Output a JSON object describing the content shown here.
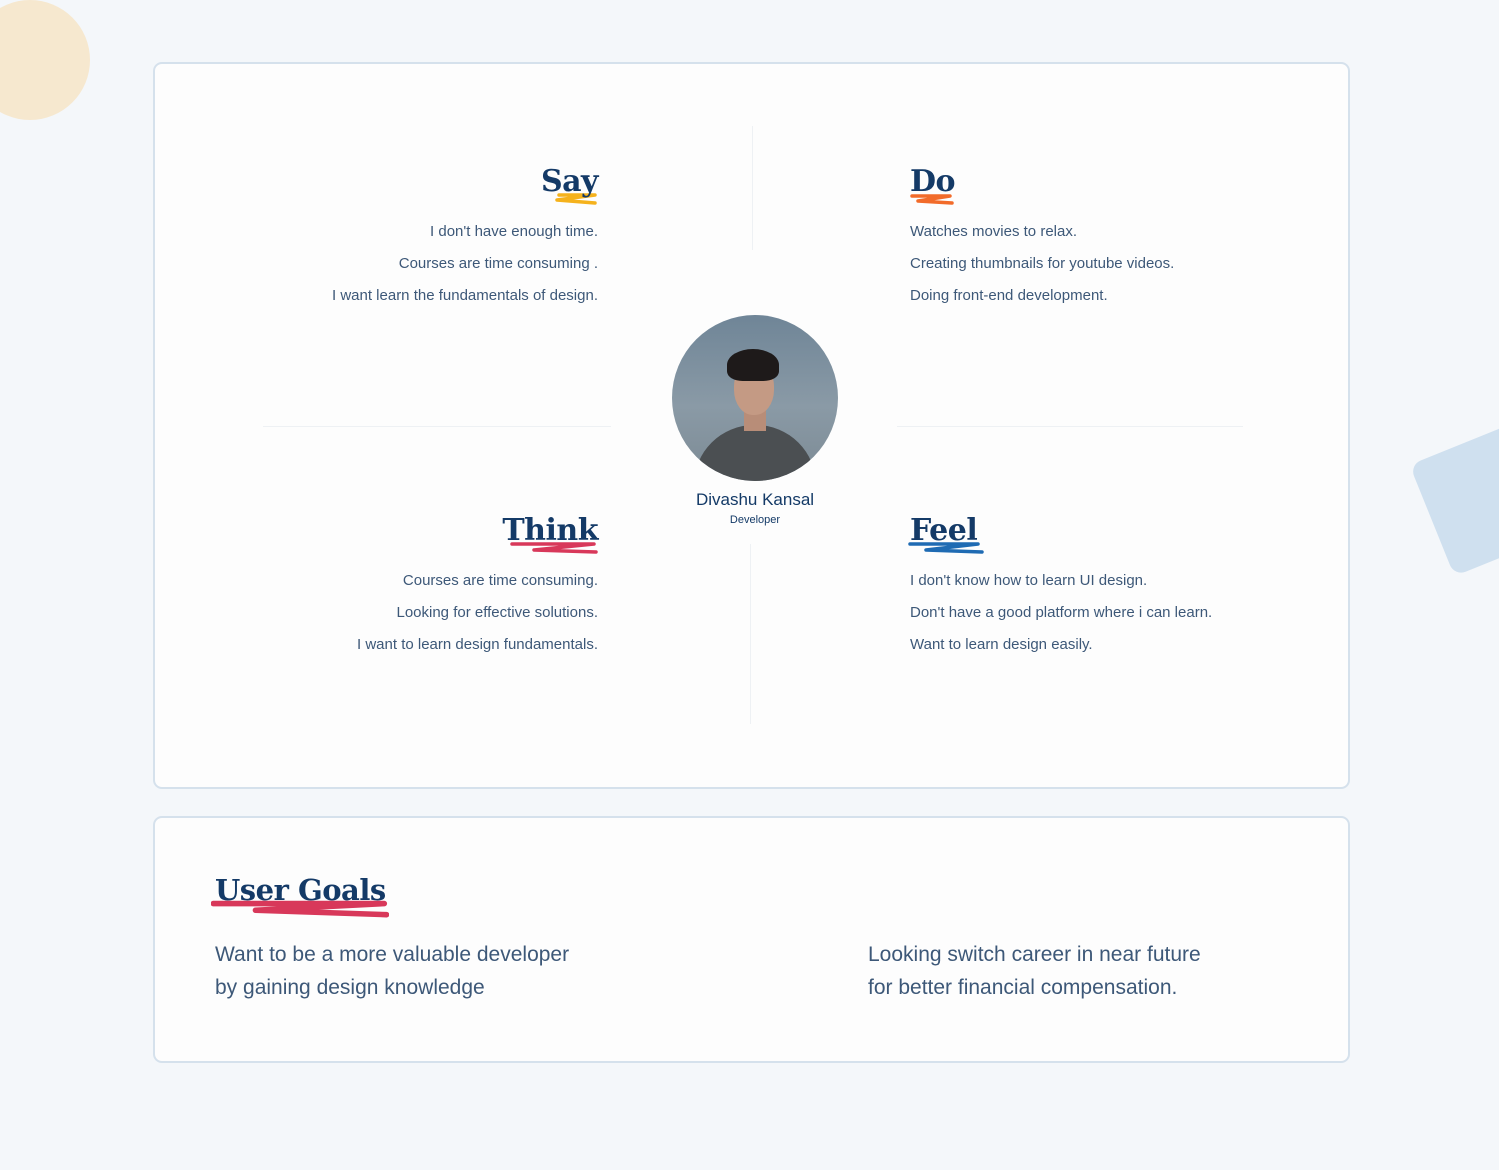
{
  "persona": {
    "name": "Divashu Kansal",
    "role": "Developer"
  },
  "quadrants": {
    "say": {
      "title": "Say",
      "accent": "#f5b21c",
      "items": [
        "I don't have enough time.",
        "Courses are time consuming .",
        "I want learn the fundamentals of design."
      ]
    },
    "do": {
      "title": "Do",
      "accent": "#f26b2a",
      "items": [
        "Watches movies to relax.",
        "Creating thumbnails for youtube videos.",
        "Doing front-end development."
      ]
    },
    "think": {
      "title": "Think",
      "accent": "#d8385a",
      "items": [
        "Courses are time consuming.",
        "Looking for effective solutions.",
        "I want to learn design fundamentals."
      ]
    },
    "feel": {
      "title": "Feel",
      "accent": "#1f6bb3",
      "items": [
        "I don't know how to learn UI design.",
        "Don't have a good platform where i can learn.",
        "Want to learn design easily."
      ]
    }
  },
  "goals": {
    "title": "User Goals",
    "accent": "#d8385a",
    "items": [
      "Want to be a more valuable developer\nby gaining design knowledge",
      "Looking switch career in near future\nfor better financial compensation."
    ]
  },
  "colors": {
    "heading": "#143a67",
    "text": "#3d5878",
    "background": "#f4f7fa",
    "card_border": "#d5e1ec"
  }
}
